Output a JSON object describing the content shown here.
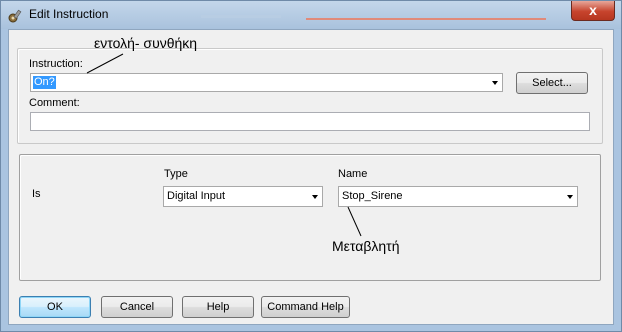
{
  "window": {
    "title": "Edit Instruction",
    "close_glyph": "x"
  },
  "instruction": {
    "label": "Instruction:",
    "value": "On?",
    "select_button": "Select..."
  },
  "comment": {
    "label": "Comment:",
    "value": ""
  },
  "operand": {
    "row_label": "Is",
    "type_header": "Type",
    "name_header": "Name",
    "type_value": "Digital Input",
    "name_value": "Stop_Sirene"
  },
  "annotations": {
    "instruction_note": "εντολή- συνθήκη",
    "variable_note": "Μεταβλητή"
  },
  "buttons": {
    "ok": "OK",
    "cancel": "Cancel",
    "help": "Help",
    "command_help": "Command Help"
  },
  "colors": {
    "selection_highlight": "#3399ff",
    "close_button": "#c7442d",
    "dialog_background": "#f0f0f0"
  },
  "icons": {
    "app": "gear-wrench-icon",
    "close": "close-icon",
    "dropdown": "chevron-down-icon"
  }
}
